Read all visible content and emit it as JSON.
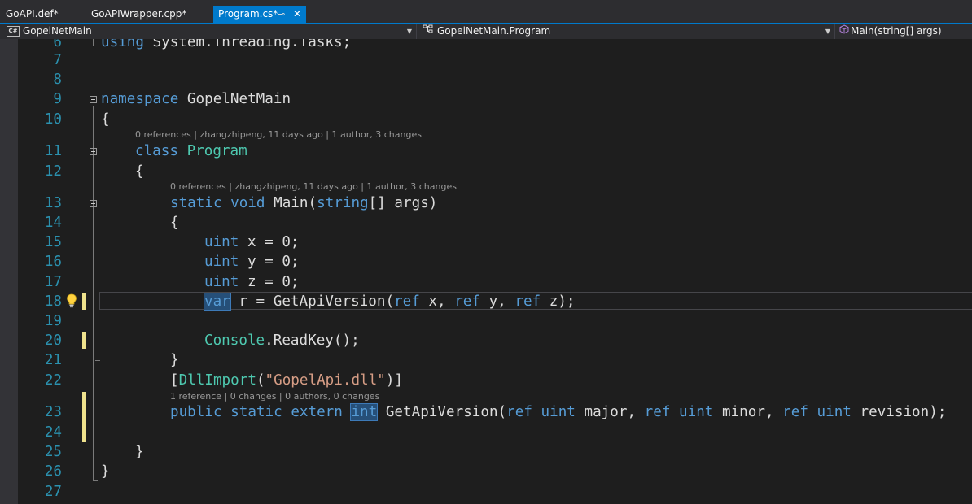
{
  "tabs": [
    {
      "label": "GoAPI.def*"
    },
    {
      "label": "GoAPIWrapper.cpp*"
    },
    {
      "label": "Program.cs*",
      "active": true
    }
  ],
  "tab_pin_icon": "pin-icon",
  "tab_close_icon": "close-icon",
  "navbar": {
    "project": "GopelNetMain",
    "type": "GopelNetMain.Program",
    "member": "Main(string[] args)"
  },
  "lines": {
    "l6": "6",
    "l7": "7",
    "l8": "8",
    "l9": "9",
    "l10": "10",
    "l11": "11",
    "l12": "12",
    "l13": "13",
    "l14": "14",
    "l15": "15",
    "l16": "16",
    "l17": "17",
    "l18": "18",
    "l19": "19",
    "l20": "20",
    "l21": "21",
    "l22": "22",
    "l23": "23",
    "l24": "24",
    "l25": "25",
    "l26": "26",
    "l27": "27"
  },
  "codelens": {
    "program": "0 references | zhangzhipeng, 11 days ago | 1 author, 3 changes",
    "main": "0 references | zhangzhipeng, 11 days ago | 1 author, 3 changes",
    "getapi": "1 reference | 0 changes | 0 authors, 0 changes"
  },
  "code": {
    "using_kw": "using",
    "using_rest": " System.Threading.Tasks;",
    "namespace_kw": "namespace",
    "namespace_name": " GopelNetMain",
    "open_brace": "{",
    "close_brace": "}",
    "class_kw": "class",
    "class_name": "Program",
    "static_kw": "static",
    "void_kw": "void",
    "main_name": "Main(",
    "string_kw": "string",
    "main_args": "[] args)",
    "uint_kw": "uint",
    "x_decl": " x = 0;",
    "y_decl": " y = 0;",
    "z_decl": " z = 0;",
    "var_kw": "var",
    "r_assign": " r = GetApiVersion(",
    "ref_kw": "ref",
    "arg_x": " x, ",
    "arg_y": " y, ",
    "arg_z": " z);",
    "console_type": "Console",
    "readkey": ".ReadKey();",
    "attr_open": "[",
    "dllimport": "DllImport",
    "paren_open": "(",
    "dll_string": "\"GopelApi.dll\"",
    "attr_close": ")]",
    "public_kw": "public",
    "extern_kw": "extern",
    "int_kw": "int",
    "getapi_name": " GetApiVersion(",
    "major": " major, ",
    "minor": " minor, ",
    "revision": " revision);",
    "space": " "
  },
  "colors": {
    "keyword": "#569cd6",
    "type": "#4ec9b0",
    "string": "#d69d85",
    "line_number": "#2b91af",
    "accent": "#007acc"
  },
  "icons": {
    "lightbulb": "lightbulb-icon",
    "csharp_project": "csharp-project-icon",
    "class": "class-icon",
    "method": "method-icon"
  }
}
